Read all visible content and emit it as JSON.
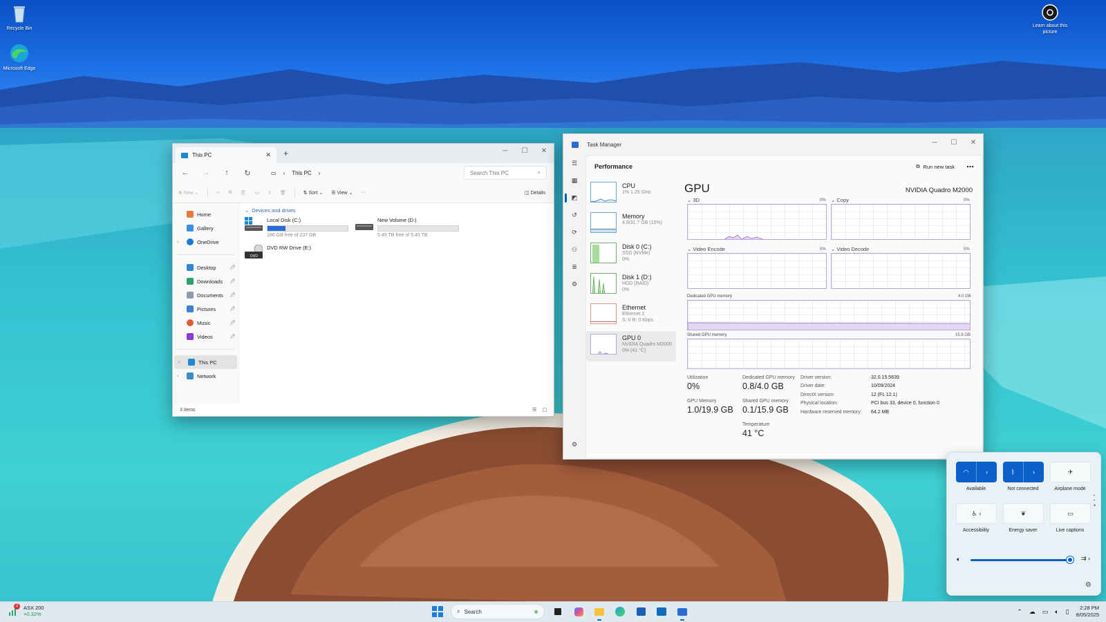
{
  "desktop": {
    "icons": [
      {
        "label": "Recycle Bin"
      },
      {
        "label": "Microsoft Edge"
      },
      {
        "label": "Learn about this picture"
      }
    ]
  },
  "explorer": {
    "tab_title": "This PC",
    "breadcrumb": "This PC",
    "search_placeholder": "Search This PC",
    "commands": {
      "new": "New",
      "sort": "Sort",
      "view": "View",
      "more": "···",
      "details": "Details"
    },
    "nav": {
      "home": "Home",
      "gallery": "Gallery",
      "onedrive": "OneDrive",
      "desktop": "Desktop",
      "downloads": "Downloads",
      "documents": "Documents",
      "pictures": "Pictures",
      "music": "Music",
      "videos": "Videos",
      "thispc": "This PC",
      "network": "Network"
    },
    "group_header": "Devices and drives",
    "drives": [
      {
        "name": "Local Disk (C:)",
        "free": "186 GB free of 237 GB",
        "used_fraction": 0.22
      },
      {
        "name": "New Volume (D:)",
        "free": "5.45 TB free of 5.45 TB",
        "used_fraction": 0.0
      },
      {
        "name": "DVD RW Drive (E:)"
      }
    ],
    "status": "3 items"
  },
  "taskmgr": {
    "title": "Task Manager",
    "section": "Performance",
    "run_new_task": "Run new task",
    "devices": [
      {
        "name": "CPU",
        "sub1": "1% 1.25 GHz",
        "sub2": ""
      },
      {
        "name": "Memory",
        "sub1": "4.9/31.7 GB (15%)",
        "sub2": ""
      },
      {
        "name": "Disk 0 (C:)",
        "sub1": "SSD (NVMe)",
        "sub2": "0%"
      },
      {
        "name": "Disk 1 (D:)",
        "sub1": "HDD (RAID)",
        "sub2": "0%"
      },
      {
        "name": "Ethernet",
        "sub1": "Ethernet 2",
        "sub2": "S: 0 R: 0 Kbps"
      },
      {
        "name": "GPU 0",
        "sub1": "NVIDIA Quadro M2000",
        "sub2": "0% (41 °C)"
      }
    ],
    "gpu": {
      "title": "GPU",
      "model": "NVIDIA Quadro M2000",
      "engines": [
        {
          "label": "3D",
          "pct": "0%"
        },
        {
          "label": "Copy",
          "pct": "0%"
        },
        {
          "label": "Video Encode",
          "pct": "0%"
        },
        {
          "label": "Video Decode",
          "pct": "0%"
        }
      ],
      "dedicated_label": "Dedicated GPU memory",
      "dedicated_max": "4.0 GB",
      "shared_label": "Shared GPU memory",
      "shared_max": "15.9 GB",
      "stats": {
        "utilization_label": "Utilization",
        "utilization": "0%",
        "dedicated_label": "Dedicated GPU memory",
        "dedicated": "0.8/4.0 GB",
        "gpu_memory_label": "GPU Memory",
        "gpu_memory": "1.0/19.9 GB",
        "shared_label": "Shared GPU memory",
        "shared": "0.1/15.9 GB",
        "temperature_label": "Temperature",
        "temperature": "41 °C"
      },
      "info": [
        {
          "k": "Driver version:",
          "v": "32.0.15.5639"
        },
        {
          "k": "Driver date:",
          "v": "10/09/2024"
        },
        {
          "k": "DirectX version:",
          "v": "12 (FL 12.1)"
        },
        {
          "k": "Physical location:",
          "v": "PCI bus 33, device 0, function 0"
        },
        {
          "k": "Hardware reserved memory:",
          "v": "64.2 MB"
        }
      ]
    }
  },
  "quick": {
    "wifi_label": "Available",
    "bluetooth_label": "Not connected",
    "airplane_label": "Airplane mode",
    "accessibility_label": "Accessibility",
    "energy_label": "Energy saver",
    "captions_label": "Live captions",
    "volume_level": 0.97
  },
  "taskbar": {
    "ticker_name": "ASX 200",
    "ticker_change": "+0.32%",
    "ticker_badge": "2",
    "search_label": "Search",
    "time": "2:28 PM",
    "date": "8/05/2025"
  },
  "colors": {
    "accent": "#0a5fc8",
    "gpu_graph": "#9b6fd0",
    "drive_fill": "#2b6cd4"
  }
}
